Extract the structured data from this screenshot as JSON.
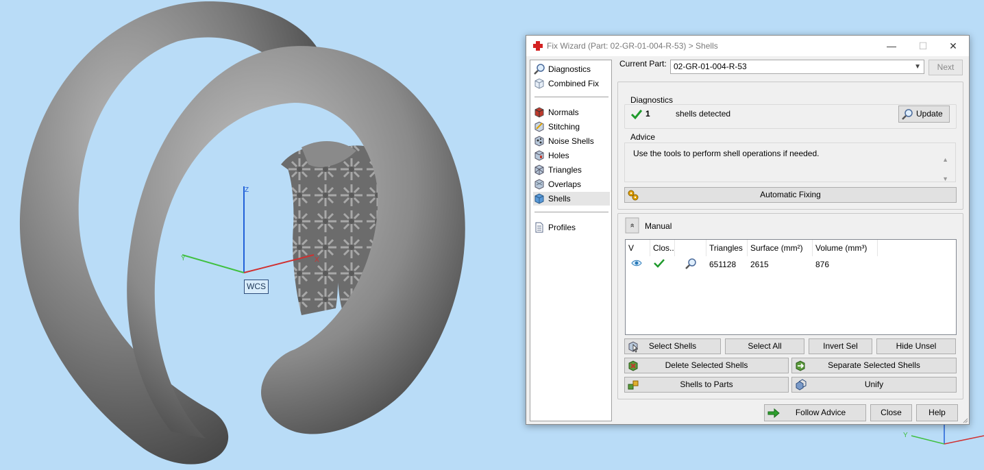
{
  "viewport": {
    "wcs_label": "WCS",
    "axis_z": "Z",
    "axis_x": "X",
    "axis_y": "Y"
  },
  "dialog": {
    "title": "Fix Wizard (Part: 02-GR-01-004-R-53) > Shells",
    "window_buttons": {
      "minimize": "—",
      "maximize": "☐",
      "close": "✕"
    },
    "nav": {
      "group1": [
        {
          "label": "Diagnostics",
          "icon": "magnifier-icon"
        },
        {
          "label": "Combined Fix",
          "icon": "cube-outline-icon"
        }
      ],
      "group2": [
        {
          "label": "Normals",
          "icon": "normals-icon"
        },
        {
          "label": "Stitching",
          "icon": "stitching-icon"
        },
        {
          "label": "Noise Shells",
          "icon": "noise-shells-icon"
        },
        {
          "label": "Holes",
          "icon": "holes-icon"
        },
        {
          "label": "Triangles",
          "icon": "triangles-icon"
        },
        {
          "label": "Overlaps",
          "icon": "overlaps-icon"
        },
        {
          "label": "Shells",
          "icon": "shells-icon",
          "selected": true
        }
      ],
      "group3": [
        {
          "label": "Profiles",
          "icon": "document-icon"
        }
      ]
    },
    "current_part_label": "Current Part:",
    "current_part_value": "02-GR-01-004-R-53",
    "next_label": "Next",
    "diagnostics": {
      "group_label": "Diagnostics",
      "count": "1",
      "text": "shells detected",
      "update_label": "Update"
    },
    "advice": {
      "group_label": "Advice",
      "text": "Use the tools to perform shell operations if needed."
    },
    "automatic_fixing_label": "Automatic Fixing",
    "manual": {
      "label": "Manual",
      "collapse_glyph": "«",
      "columns": [
        "V",
        "Clos...",
        "",
        "Triangles",
        "Surface (mm²)",
        "Volume (mm³)"
      ],
      "rows": [
        {
          "triangles": "651128",
          "surface": "2615",
          "volume": "876"
        }
      ]
    },
    "buttons": {
      "select_shells": "Select Shells",
      "select_all": "Select All",
      "invert_sel": "Invert Sel",
      "hide_unsel": "Hide Unsel",
      "delete_selected_shells": "Delete Selected Shells",
      "separate_selected_shells": "Separate Selected Shells",
      "shells_to_parts": "Shells to Parts",
      "unify": "Unify",
      "follow_advice": "Follow Advice",
      "close": "Close",
      "help": "Help"
    }
  },
  "colors": {
    "background": "#b9dcf7",
    "accent_red": "#d42222",
    "check_green": "#1f9a2c",
    "axis_blue": "#2060d8",
    "axis_red": "#d03030",
    "axis_green": "#40c040"
  }
}
